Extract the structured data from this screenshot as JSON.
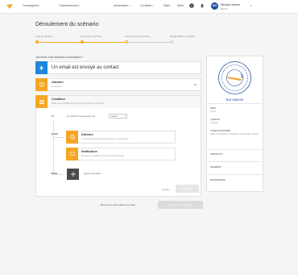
{
  "nav": {
    "items": [
      {
        "label": "Campagnes",
        "has_caret": true
      },
      {
        "label": "Transactionnel",
        "has_caret": true
      },
      {
        "label": "Automation",
        "has_caret": true
      },
      {
        "label": "Contacts",
        "has_caret": true
      },
      {
        "label": "Stats",
        "has_caret": false
      },
      {
        "label": "Sites",
        "has_caret": false
      }
    ],
    "icons": [
      "help-icon",
      "bell-icon"
    ]
  },
  "user": {
    "initials": "NG",
    "name": "Nicolas Garnier",
    "org": "Breizh"
  },
  "page": {
    "title": "Déroulement du scénario"
  },
  "stepper": {
    "steps": [
      {
        "label": "Type de scénario",
        "state": "done"
      },
      {
        "label": "Informations de base",
        "state": "done"
      },
      {
        "label": "Déroulement du scénario",
        "state": "current"
      },
      {
        "label": "Récapitulatif et activation",
        "state": "todo"
      }
    ]
  },
  "builder": {
    "question": "Qui lance votre scénario d'automation ?",
    "trigger_label": "Un email est envoyé au contact",
    "wait": {
      "title": "Attendre",
      "subtitle": "10 Minutes"
    },
    "condition": {
      "title": "Condition",
      "subtitle": "Définir une condition à remplir pour continuer le scénario",
      "if_label": "Si",
      "if_text": "Le statut du mail envoyé est",
      "if_value": "ouvert"
    },
    "branch_yes_label": "ALORS",
    "branch_no_label": "SINON",
    "actions": [
      {
        "title": "Attendre",
        "subtitle": "Si la durée à attendre avant d'exécuter une autre action"
      },
      {
        "title": "Notification",
        "subtitle": "Envoyer une notification mail, sms ou push mobile"
      }
    ],
    "add_action_label": "Ajouter une action",
    "cancel_label": "Annuler",
    "validate_label": "Enregistrer"
  },
  "sidebar": {
    "title": "Sur mesure",
    "fields": [
      {
        "label": "NOM",
        "value": "Test 8"
      },
      {
        "label": "LANGUE",
        "value": "Français"
      },
      {
        "label": "FUSEAU HORAIRE",
        "value": "(GMT+01:00) Paris, Bruxelles, Copenhague, Madrid"
      }
    ],
    "sections": [
      "CONTACTS",
      "SEGMENT",
      "DESTINAIRES"
    ]
  },
  "footer": {
    "back_label": "Retour aux informations de base",
    "next_label": "Enregistrer le scénario"
  },
  "colors": {
    "accent": "#f5a623",
    "trigger": "#1f86d9",
    "dark": "#4a4a4a",
    "stepper_done": "#f5a623",
    "stepper_todo": "#cccccc"
  }
}
